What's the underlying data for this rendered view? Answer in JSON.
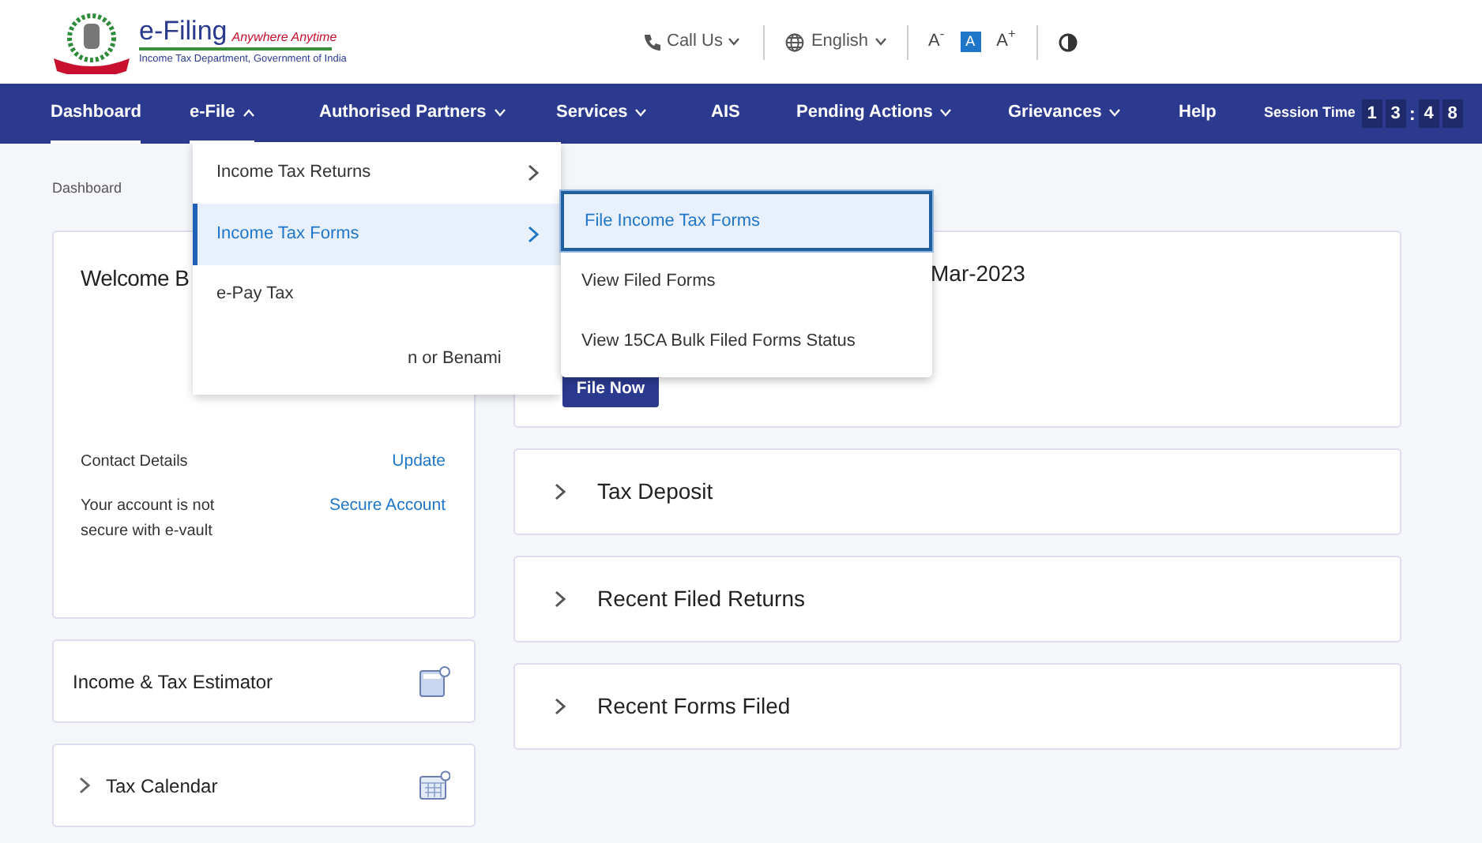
{
  "header": {
    "logo_title": "e-Filing",
    "logo_tagline": "Anywhere Anytime",
    "logo_subtitle": "Income Tax Department, Government of India",
    "call_us": "Call Us",
    "language": "English",
    "font_controls": [
      {
        "label": "A$^{-}$",
        "selected": false
      },
      {
        "label": "A",
        "selected": true
      },
      {
        "label": "A$^{+}$",
        "selected": false
      }
    ]
  },
  "nav": {
    "items": [
      {
        "label": "Dashboard",
        "selected": true,
        "has_menu": false
      },
      {
        "label": "e-File",
        "selected": true,
        "has_menu": true,
        "expanded": true
      },
      {
        "label": "Authorised Partners",
        "selected": false,
        "has_menu": true,
        "expanded": false
      },
      {
        "label": "Services",
        "selected": false,
        "has_menu": true,
        "expanded": false
      },
      {
        "label": "AIS",
        "selected": false,
        "has_menu": false
      },
      {
        "label": "Pending Actions",
        "selected": false,
        "has_menu": true,
        "expanded": false
      },
      {
        "label": "Grievances",
        "selected": false,
        "has_menu": true,
        "expanded": false
      },
      {
        "label": "Help",
        "selected": false,
        "has_menu": false
      }
    ],
    "session_label": "Session Time",
    "session_digits": [
      "1",
      "3",
      ":",
      "4",
      "8"
    ]
  },
  "breadcrumb": "Dashboard",
  "efile_menu": {
    "items": [
      {
        "label": "Income Tax Returns",
        "selected": false,
        "has_submenu": true
      },
      {
        "label": "Income Tax Forms",
        "selected": true,
        "has_submenu": true
      },
      {
        "label": "e-Pay Tax",
        "selected": false,
        "has_submenu": false
      },
      {
        "label": "n or Benami",
        "selected": false,
        "has_submenu": false
      }
    ]
  },
  "submenu": {
    "items": [
      {
        "label": "File Income Tax Forms",
        "selected": true
      },
      {
        "label": "View Filed Forms",
        "selected": false
      },
      {
        "label": "View 15CA Bulk Filed Forms Status",
        "selected": false
      }
    ]
  },
  "welcome_card": {
    "title": "Welcome B",
    "contact_label": "Contact Details",
    "contact_action": "Update",
    "security_text": "Your account is not secure with e-vault",
    "security_action": "Secure Account"
  },
  "estimator": {
    "label": "Income & Tax Estimator"
  },
  "tax_calendar": {
    "label": "Tax Calendar"
  },
  "filing_card": {
    "title": "Mar-2023",
    "button": "File Now"
  },
  "sections": [
    {
      "label": "Tax Deposit"
    },
    {
      "label": "Recent Filed Returns"
    },
    {
      "label": "Recent Forms Filed"
    }
  ]
}
